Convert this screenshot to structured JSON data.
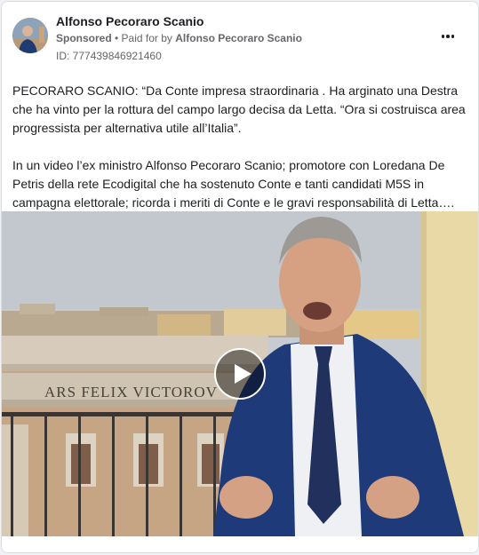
{
  "post": {
    "author": "Alfonso Pecoraro Scanio",
    "sponsored_label": "Sponsored",
    "separator": " • ",
    "paid_for_prefix": "Paid for by ",
    "payer": "Alfonso Pecoraro Scanio",
    "ad_id": "ID: 777439846921460",
    "paragraph_1": "PECORARO SCANIO: “Da Conte impresa straordinaria . Ha arginato una Destra che ha vinto per la rottura del campo largo decisa da Letta. “Ora si costruisca area progressista per alternativa utile all’Italia”.",
    "paragraph_2": "In un video l’ex ministro Alfonso Pecoraro Scanio; promotore con Loredana De Petris della rete Ecodigital che ha sostenuto Conte e tanti candidati M5S in campagna elettorale; ricorda i meriti di Conte e le gravi responsabilità di Letta…."
  },
  "video": {
    "building_inscription": "ARS FELIX VICTOROV"
  },
  "icons": {
    "more": "more-options-icon",
    "play": "play-icon",
    "avatar": "profile-avatar"
  }
}
